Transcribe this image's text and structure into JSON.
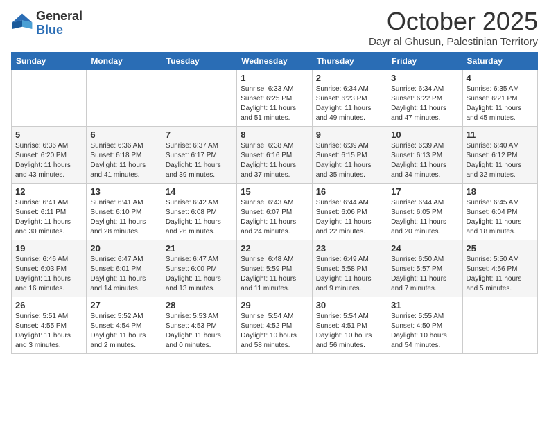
{
  "header": {
    "logo_general": "General",
    "logo_blue": "Blue",
    "month_title": "October 2025",
    "subtitle": "Dayr al Ghusun, Palestinian Territory"
  },
  "weekdays": [
    "Sunday",
    "Monday",
    "Tuesday",
    "Wednesday",
    "Thursday",
    "Friday",
    "Saturday"
  ],
  "weeks": [
    [
      {
        "day": "",
        "info": ""
      },
      {
        "day": "",
        "info": ""
      },
      {
        "day": "",
        "info": ""
      },
      {
        "day": "1",
        "info": "Sunrise: 6:33 AM\nSunset: 6:25 PM\nDaylight: 11 hours\nand 51 minutes."
      },
      {
        "day": "2",
        "info": "Sunrise: 6:34 AM\nSunset: 6:23 PM\nDaylight: 11 hours\nand 49 minutes."
      },
      {
        "day": "3",
        "info": "Sunrise: 6:34 AM\nSunset: 6:22 PM\nDaylight: 11 hours\nand 47 minutes."
      },
      {
        "day": "4",
        "info": "Sunrise: 6:35 AM\nSunset: 6:21 PM\nDaylight: 11 hours\nand 45 minutes."
      }
    ],
    [
      {
        "day": "5",
        "info": "Sunrise: 6:36 AM\nSunset: 6:20 PM\nDaylight: 11 hours\nand 43 minutes."
      },
      {
        "day": "6",
        "info": "Sunrise: 6:36 AM\nSunset: 6:18 PM\nDaylight: 11 hours\nand 41 minutes."
      },
      {
        "day": "7",
        "info": "Sunrise: 6:37 AM\nSunset: 6:17 PM\nDaylight: 11 hours\nand 39 minutes."
      },
      {
        "day": "8",
        "info": "Sunrise: 6:38 AM\nSunset: 6:16 PM\nDaylight: 11 hours\nand 37 minutes."
      },
      {
        "day": "9",
        "info": "Sunrise: 6:39 AM\nSunset: 6:15 PM\nDaylight: 11 hours\nand 35 minutes."
      },
      {
        "day": "10",
        "info": "Sunrise: 6:39 AM\nSunset: 6:13 PM\nDaylight: 11 hours\nand 34 minutes."
      },
      {
        "day": "11",
        "info": "Sunrise: 6:40 AM\nSunset: 6:12 PM\nDaylight: 11 hours\nand 32 minutes."
      }
    ],
    [
      {
        "day": "12",
        "info": "Sunrise: 6:41 AM\nSunset: 6:11 PM\nDaylight: 11 hours\nand 30 minutes."
      },
      {
        "day": "13",
        "info": "Sunrise: 6:41 AM\nSunset: 6:10 PM\nDaylight: 11 hours\nand 28 minutes."
      },
      {
        "day": "14",
        "info": "Sunrise: 6:42 AM\nSunset: 6:08 PM\nDaylight: 11 hours\nand 26 minutes."
      },
      {
        "day": "15",
        "info": "Sunrise: 6:43 AM\nSunset: 6:07 PM\nDaylight: 11 hours\nand 24 minutes."
      },
      {
        "day": "16",
        "info": "Sunrise: 6:44 AM\nSunset: 6:06 PM\nDaylight: 11 hours\nand 22 minutes."
      },
      {
        "day": "17",
        "info": "Sunrise: 6:44 AM\nSunset: 6:05 PM\nDaylight: 11 hours\nand 20 minutes."
      },
      {
        "day": "18",
        "info": "Sunrise: 6:45 AM\nSunset: 6:04 PM\nDaylight: 11 hours\nand 18 minutes."
      }
    ],
    [
      {
        "day": "19",
        "info": "Sunrise: 6:46 AM\nSunset: 6:03 PM\nDaylight: 11 hours\nand 16 minutes."
      },
      {
        "day": "20",
        "info": "Sunrise: 6:47 AM\nSunset: 6:01 PM\nDaylight: 11 hours\nand 14 minutes."
      },
      {
        "day": "21",
        "info": "Sunrise: 6:47 AM\nSunset: 6:00 PM\nDaylight: 11 hours\nand 13 minutes."
      },
      {
        "day": "22",
        "info": "Sunrise: 6:48 AM\nSunset: 5:59 PM\nDaylight: 11 hours\nand 11 minutes."
      },
      {
        "day": "23",
        "info": "Sunrise: 6:49 AM\nSunset: 5:58 PM\nDaylight: 11 hours\nand 9 minutes."
      },
      {
        "day": "24",
        "info": "Sunrise: 6:50 AM\nSunset: 5:57 PM\nDaylight: 11 hours\nand 7 minutes."
      },
      {
        "day": "25",
        "info": "Sunrise: 5:50 AM\nSunset: 4:56 PM\nDaylight: 11 hours\nand 5 minutes."
      }
    ],
    [
      {
        "day": "26",
        "info": "Sunrise: 5:51 AM\nSunset: 4:55 PM\nDaylight: 11 hours\nand 3 minutes."
      },
      {
        "day": "27",
        "info": "Sunrise: 5:52 AM\nSunset: 4:54 PM\nDaylight: 11 hours\nand 2 minutes."
      },
      {
        "day": "28",
        "info": "Sunrise: 5:53 AM\nSunset: 4:53 PM\nDaylight: 11 hours\nand 0 minutes."
      },
      {
        "day": "29",
        "info": "Sunrise: 5:54 AM\nSunset: 4:52 PM\nDaylight: 10 hours\nand 58 minutes."
      },
      {
        "day": "30",
        "info": "Sunrise: 5:54 AM\nSunset: 4:51 PM\nDaylight: 10 hours\nand 56 minutes."
      },
      {
        "day": "31",
        "info": "Sunrise: 5:55 AM\nSunset: 4:50 PM\nDaylight: 10 hours\nand 54 minutes."
      },
      {
        "day": "",
        "info": ""
      }
    ]
  ]
}
